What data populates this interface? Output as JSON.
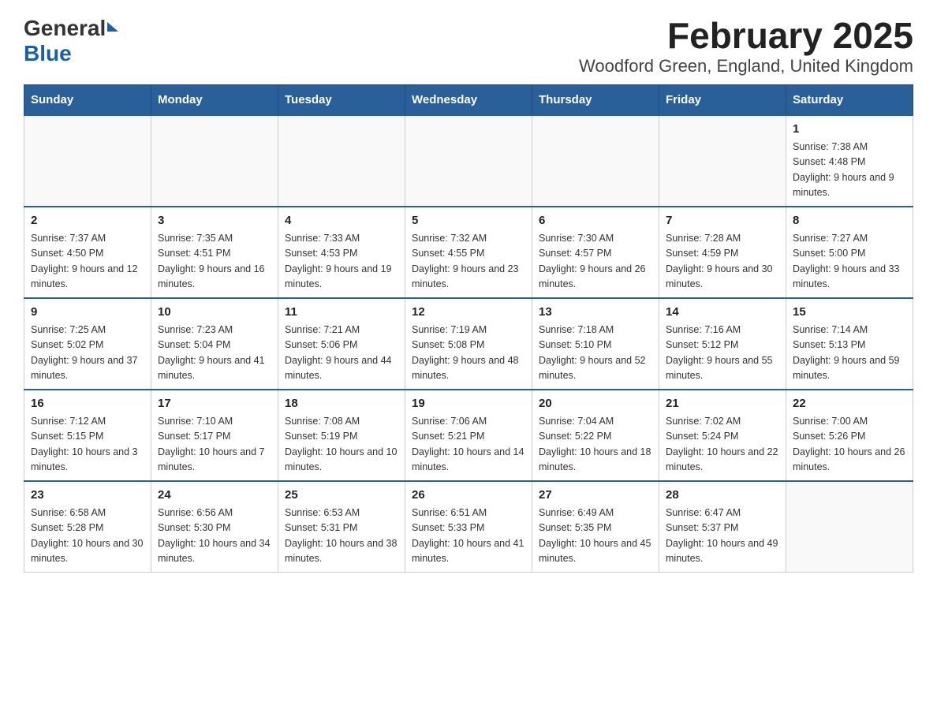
{
  "header": {
    "logo_general": "General",
    "logo_blue": "Blue",
    "title": "February 2025",
    "subtitle": "Woodford Green, England, United Kingdom"
  },
  "weekdays": [
    "Sunday",
    "Monday",
    "Tuesday",
    "Wednesday",
    "Thursday",
    "Friday",
    "Saturday"
  ],
  "weeks": [
    [
      {
        "day": "",
        "info": ""
      },
      {
        "day": "",
        "info": ""
      },
      {
        "day": "",
        "info": ""
      },
      {
        "day": "",
        "info": ""
      },
      {
        "day": "",
        "info": ""
      },
      {
        "day": "",
        "info": ""
      },
      {
        "day": "1",
        "info": "Sunrise: 7:38 AM\nSunset: 4:48 PM\nDaylight: 9 hours and 9 minutes."
      }
    ],
    [
      {
        "day": "2",
        "info": "Sunrise: 7:37 AM\nSunset: 4:50 PM\nDaylight: 9 hours and 12 minutes."
      },
      {
        "day": "3",
        "info": "Sunrise: 7:35 AM\nSunset: 4:51 PM\nDaylight: 9 hours and 16 minutes."
      },
      {
        "day": "4",
        "info": "Sunrise: 7:33 AM\nSunset: 4:53 PM\nDaylight: 9 hours and 19 minutes."
      },
      {
        "day": "5",
        "info": "Sunrise: 7:32 AM\nSunset: 4:55 PM\nDaylight: 9 hours and 23 minutes."
      },
      {
        "day": "6",
        "info": "Sunrise: 7:30 AM\nSunset: 4:57 PM\nDaylight: 9 hours and 26 minutes."
      },
      {
        "day": "7",
        "info": "Sunrise: 7:28 AM\nSunset: 4:59 PM\nDaylight: 9 hours and 30 minutes."
      },
      {
        "day": "8",
        "info": "Sunrise: 7:27 AM\nSunset: 5:00 PM\nDaylight: 9 hours and 33 minutes."
      }
    ],
    [
      {
        "day": "9",
        "info": "Sunrise: 7:25 AM\nSunset: 5:02 PM\nDaylight: 9 hours and 37 minutes."
      },
      {
        "day": "10",
        "info": "Sunrise: 7:23 AM\nSunset: 5:04 PM\nDaylight: 9 hours and 41 minutes."
      },
      {
        "day": "11",
        "info": "Sunrise: 7:21 AM\nSunset: 5:06 PM\nDaylight: 9 hours and 44 minutes."
      },
      {
        "day": "12",
        "info": "Sunrise: 7:19 AM\nSunset: 5:08 PM\nDaylight: 9 hours and 48 minutes."
      },
      {
        "day": "13",
        "info": "Sunrise: 7:18 AM\nSunset: 5:10 PM\nDaylight: 9 hours and 52 minutes."
      },
      {
        "day": "14",
        "info": "Sunrise: 7:16 AM\nSunset: 5:12 PM\nDaylight: 9 hours and 55 minutes."
      },
      {
        "day": "15",
        "info": "Sunrise: 7:14 AM\nSunset: 5:13 PM\nDaylight: 9 hours and 59 minutes."
      }
    ],
    [
      {
        "day": "16",
        "info": "Sunrise: 7:12 AM\nSunset: 5:15 PM\nDaylight: 10 hours and 3 minutes."
      },
      {
        "day": "17",
        "info": "Sunrise: 7:10 AM\nSunset: 5:17 PM\nDaylight: 10 hours and 7 minutes."
      },
      {
        "day": "18",
        "info": "Sunrise: 7:08 AM\nSunset: 5:19 PM\nDaylight: 10 hours and 10 minutes."
      },
      {
        "day": "19",
        "info": "Sunrise: 7:06 AM\nSunset: 5:21 PM\nDaylight: 10 hours and 14 minutes."
      },
      {
        "day": "20",
        "info": "Sunrise: 7:04 AM\nSunset: 5:22 PM\nDaylight: 10 hours and 18 minutes."
      },
      {
        "day": "21",
        "info": "Sunrise: 7:02 AM\nSunset: 5:24 PM\nDaylight: 10 hours and 22 minutes."
      },
      {
        "day": "22",
        "info": "Sunrise: 7:00 AM\nSunset: 5:26 PM\nDaylight: 10 hours and 26 minutes."
      }
    ],
    [
      {
        "day": "23",
        "info": "Sunrise: 6:58 AM\nSunset: 5:28 PM\nDaylight: 10 hours and 30 minutes."
      },
      {
        "day": "24",
        "info": "Sunrise: 6:56 AM\nSunset: 5:30 PM\nDaylight: 10 hours and 34 minutes."
      },
      {
        "day": "25",
        "info": "Sunrise: 6:53 AM\nSunset: 5:31 PM\nDaylight: 10 hours and 38 minutes."
      },
      {
        "day": "26",
        "info": "Sunrise: 6:51 AM\nSunset: 5:33 PM\nDaylight: 10 hours and 41 minutes."
      },
      {
        "day": "27",
        "info": "Sunrise: 6:49 AM\nSunset: 5:35 PM\nDaylight: 10 hours and 45 minutes."
      },
      {
        "day": "28",
        "info": "Sunrise: 6:47 AM\nSunset: 5:37 PM\nDaylight: 10 hours and 49 minutes."
      },
      {
        "day": "",
        "info": ""
      }
    ]
  ]
}
